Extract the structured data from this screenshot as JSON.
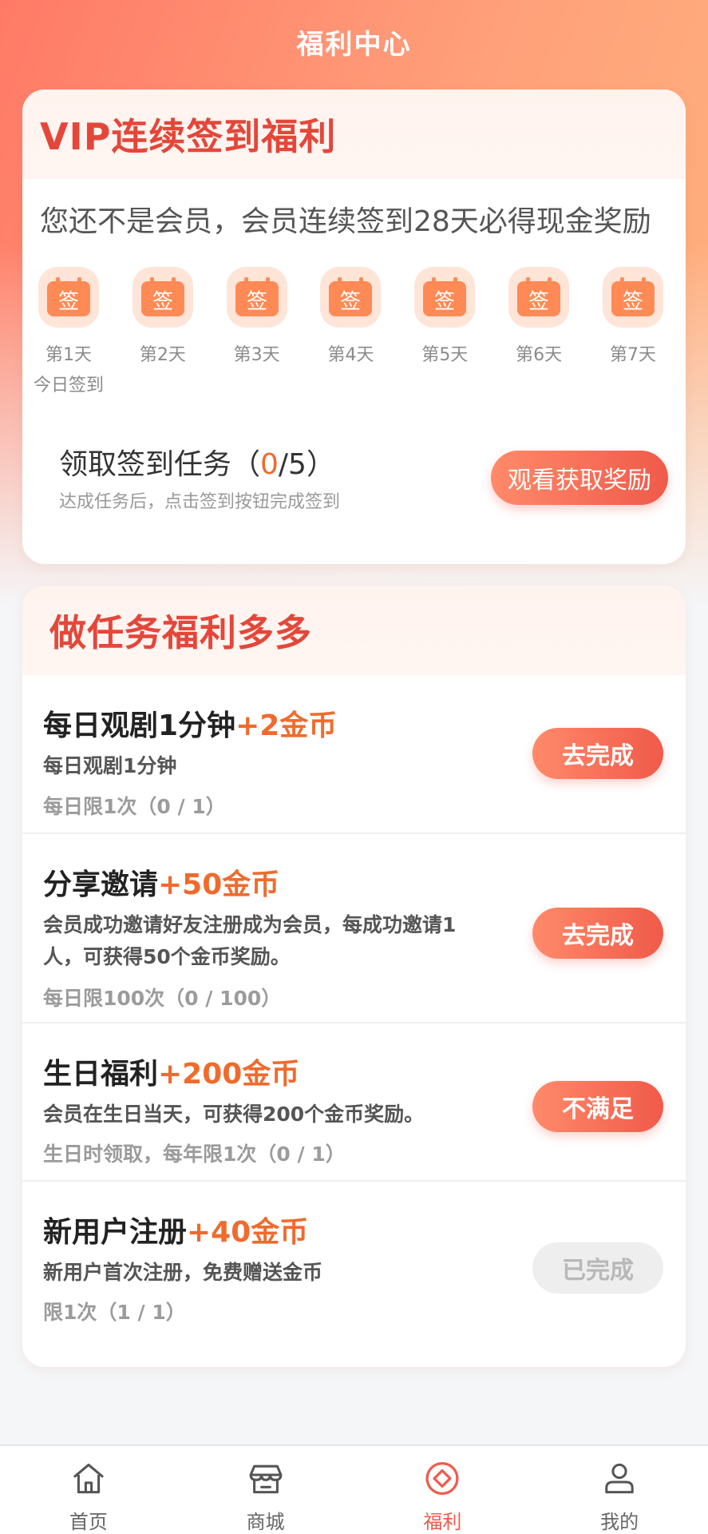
{
  "header": {
    "title": "福利中心"
  },
  "vip": {
    "title": "VIP连续签到福利",
    "subtitle": "您还不是会员，会员连续签到28天必得现金奖励",
    "badge_char": "签",
    "days": [
      {
        "label": "第1天",
        "note": "今日签到"
      },
      {
        "label": "第2天"
      },
      {
        "label": "第3天"
      },
      {
        "label": "第4天"
      },
      {
        "label": "第5天"
      },
      {
        "label": "第6天"
      },
      {
        "label": "第7天"
      }
    ],
    "task": {
      "title_prefix": "领取签到任务（",
      "progress_done": "0",
      "progress_total": "/5）",
      "desc": "达成任务后，点击签到按钮完成签到",
      "button": "观看获取奖励"
    }
  },
  "tasks": {
    "title": "做任务福利多多",
    "items": [
      {
        "name": "每日观剧1分钟",
        "reward": "+2金币",
        "desc": "每日观剧1分钟",
        "limit": "每日限1次（0 / 1）",
        "button": "去完成",
        "state": "active"
      },
      {
        "name": "分享邀请",
        "reward": "+50金币",
        "desc": "会员成功邀请好友注册成为会员，每成功邀请1人，可获得50个金币奖励。",
        "limit": "每日限100次（0 / 100）",
        "button": "去完成",
        "state": "active"
      },
      {
        "name": "生日福利",
        "reward": "+200金币",
        "desc": "会员在生日当天，可获得200个金币奖励。",
        "limit": "生日时领取，每年限1次（0 / 1）",
        "button": "不满足",
        "state": "active"
      },
      {
        "name": "新用户注册",
        "reward": "+40金币",
        "desc": "新用户首次注册，免费赠送金币",
        "limit": "限1次（1 / 1）",
        "button": "已完成",
        "state": "done"
      }
    ]
  },
  "nav": {
    "items": [
      {
        "label": "首页",
        "icon": "home-icon"
      },
      {
        "label": "商城",
        "icon": "store-icon"
      },
      {
        "label": "福利",
        "icon": "welfare-icon",
        "active": true
      },
      {
        "label": "我的",
        "icon": "profile-icon"
      }
    ]
  },
  "colors": {
    "accent": "#ef5b4c",
    "reward": "#ef6b2d",
    "title_red": "#e4473a"
  }
}
